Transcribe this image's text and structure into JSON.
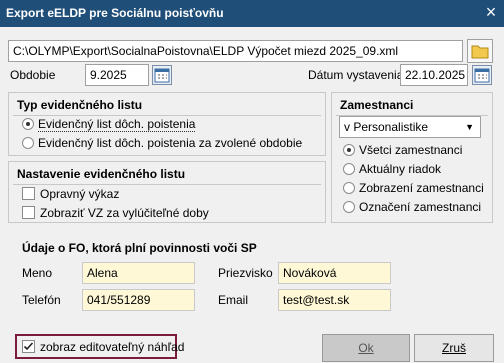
{
  "window": {
    "title": "Export eELDP pre Sociálnu poisťovňu",
    "close": "×"
  },
  "file_path": "C:\\OLYMP\\Export\\SocialnaPoistovna\\ELDP Výpočet miezd 2025_09.xml",
  "obdobie": {
    "label": "Obdobie",
    "value": "9.2025"
  },
  "datum": {
    "label": "Dátum vystavenia",
    "value": "22.10.2025"
  },
  "typ": {
    "title": "Typ evidenčného listu",
    "options": [
      "Evidenčný list dôch. poistenia",
      "Evidenčný list dôch. poistenia za zvolené obdobie"
    ]
  },
  "nastavenie": {
    "title": "Nastavenie evidenčného listu",
    "options": [
      "Opravný výkaz",
      "Zobraziť VZ za vylúčiteľné doby"
    ]
  },
  "zamestnanci": {
    "title": "Zamestnanci",
    "dropdown": "v Personalistike",
    "options": [
      "Všetci zamestnanci",
      "Aktuálny riadok",
      "Zobrazení zamestnanci",
      "Označení zamestnanci"
    ]
  },
  "udaje": {
    "title": "Údaje o FO, ktorá plní povinnosti voči SP",
    "meno_label": "Meno",
    "meno": "Alena",
    "priezvisko_label": "Priezvisko",
    "priezvisko": "Nováková",
    "telefon_label": "Telefón",
    "telefon": "041/551289",
    "email_label": "Email",
    "email": "test@test.sk"
  },
  "editable_preview": "zobraz editovateľný náhľad",
  "buttons": {
    "ok": "Ok",
    "cancel": "Zruš"
  }
}
